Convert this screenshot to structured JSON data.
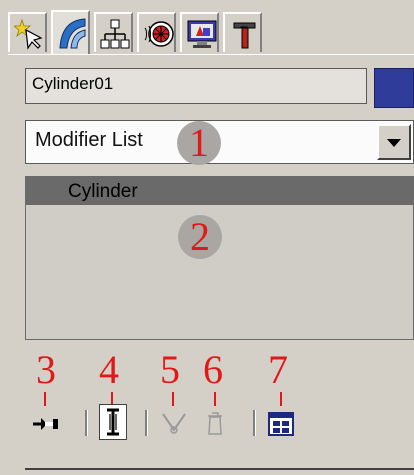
{
  "tabs": [
    {
      "icon": "create-icon"
    },
    {
      "icon": "modify-icon"
    },
    {
      "icon": "hierarchy-icon"
    },
    {
      "icon": "motion-icon"
    },
    {
      "icon": "display-icon"
    },
    {
      "icon": "utilities-icon"
    }
  ],
  "object": {
    "name": "Cylinder01",
    "color": "#2f3c9a"
  },
  "modifier_list": {
    "label": "Modifier List"
  },
  "stack": {
    "items": [
      {
        "label": "Cylinder"
      }
    ]
  },
  "callouts": {
    "c1": "1",
    "c2": "2",
    "c3": "3",
    "c4": "4",
    "c5": "5",
    "c6": "6",
    "c7": "7"
  },
  "toolbar": [
    {
      "icon": "pin-stack-icon"
    },
    {
      "icon": "show-end-result-icon"
    },
    {
      "icon": "make-unique-icon"
    },
    {
      "icon": "remove-modifier-icon"
    },
    {
      "icon": "configure-modifier-sets-icon"
    }
  ],
  "colors": {
    "panel": "#d4d0c8",
    "callout_red": "#e01818",
    "selected": "#6a6a6a"
  }
}
